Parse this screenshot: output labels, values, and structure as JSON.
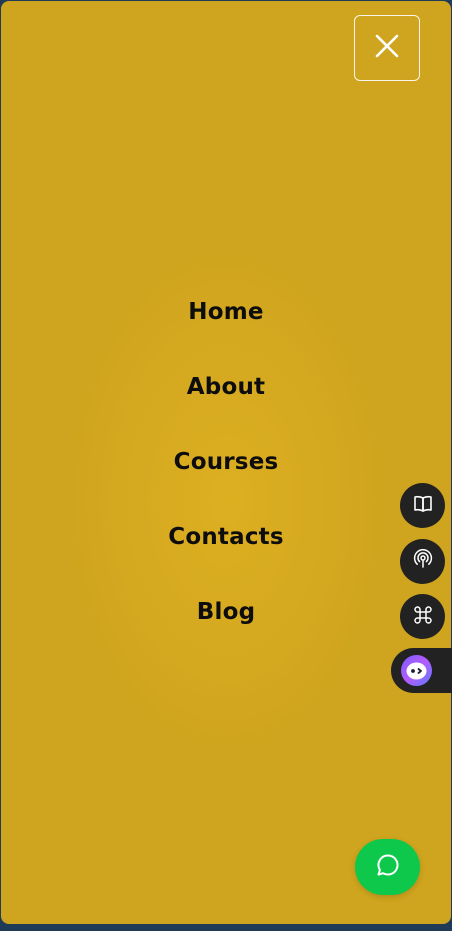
{
  "menu": {
    "items": [
      {
        "label": "Home"
      },
      {
        "label": "About"
      },
      {
        "label": "Courses"
      },
      {
        "label": "Contacts"
      },
      {
        "label": "Blog"
      }
    ]
  },
  "icons": {
    "close": "close-icon",
    "side_buttons": [
      "book-icon",
      "podcast-icon",
      "command-icon"
    ],
    "side_tab": "assistant-face-icon",
    "chat": "chat-bubble-icon"
  },
  "colors": {
    "menu_background": "#cfa41e",
    "text": "#0d0d0d",
    "side_button": "#222222",
    "chat_button": "#0ec84c",
    "page_border": "#1f3b57"
  }
}
